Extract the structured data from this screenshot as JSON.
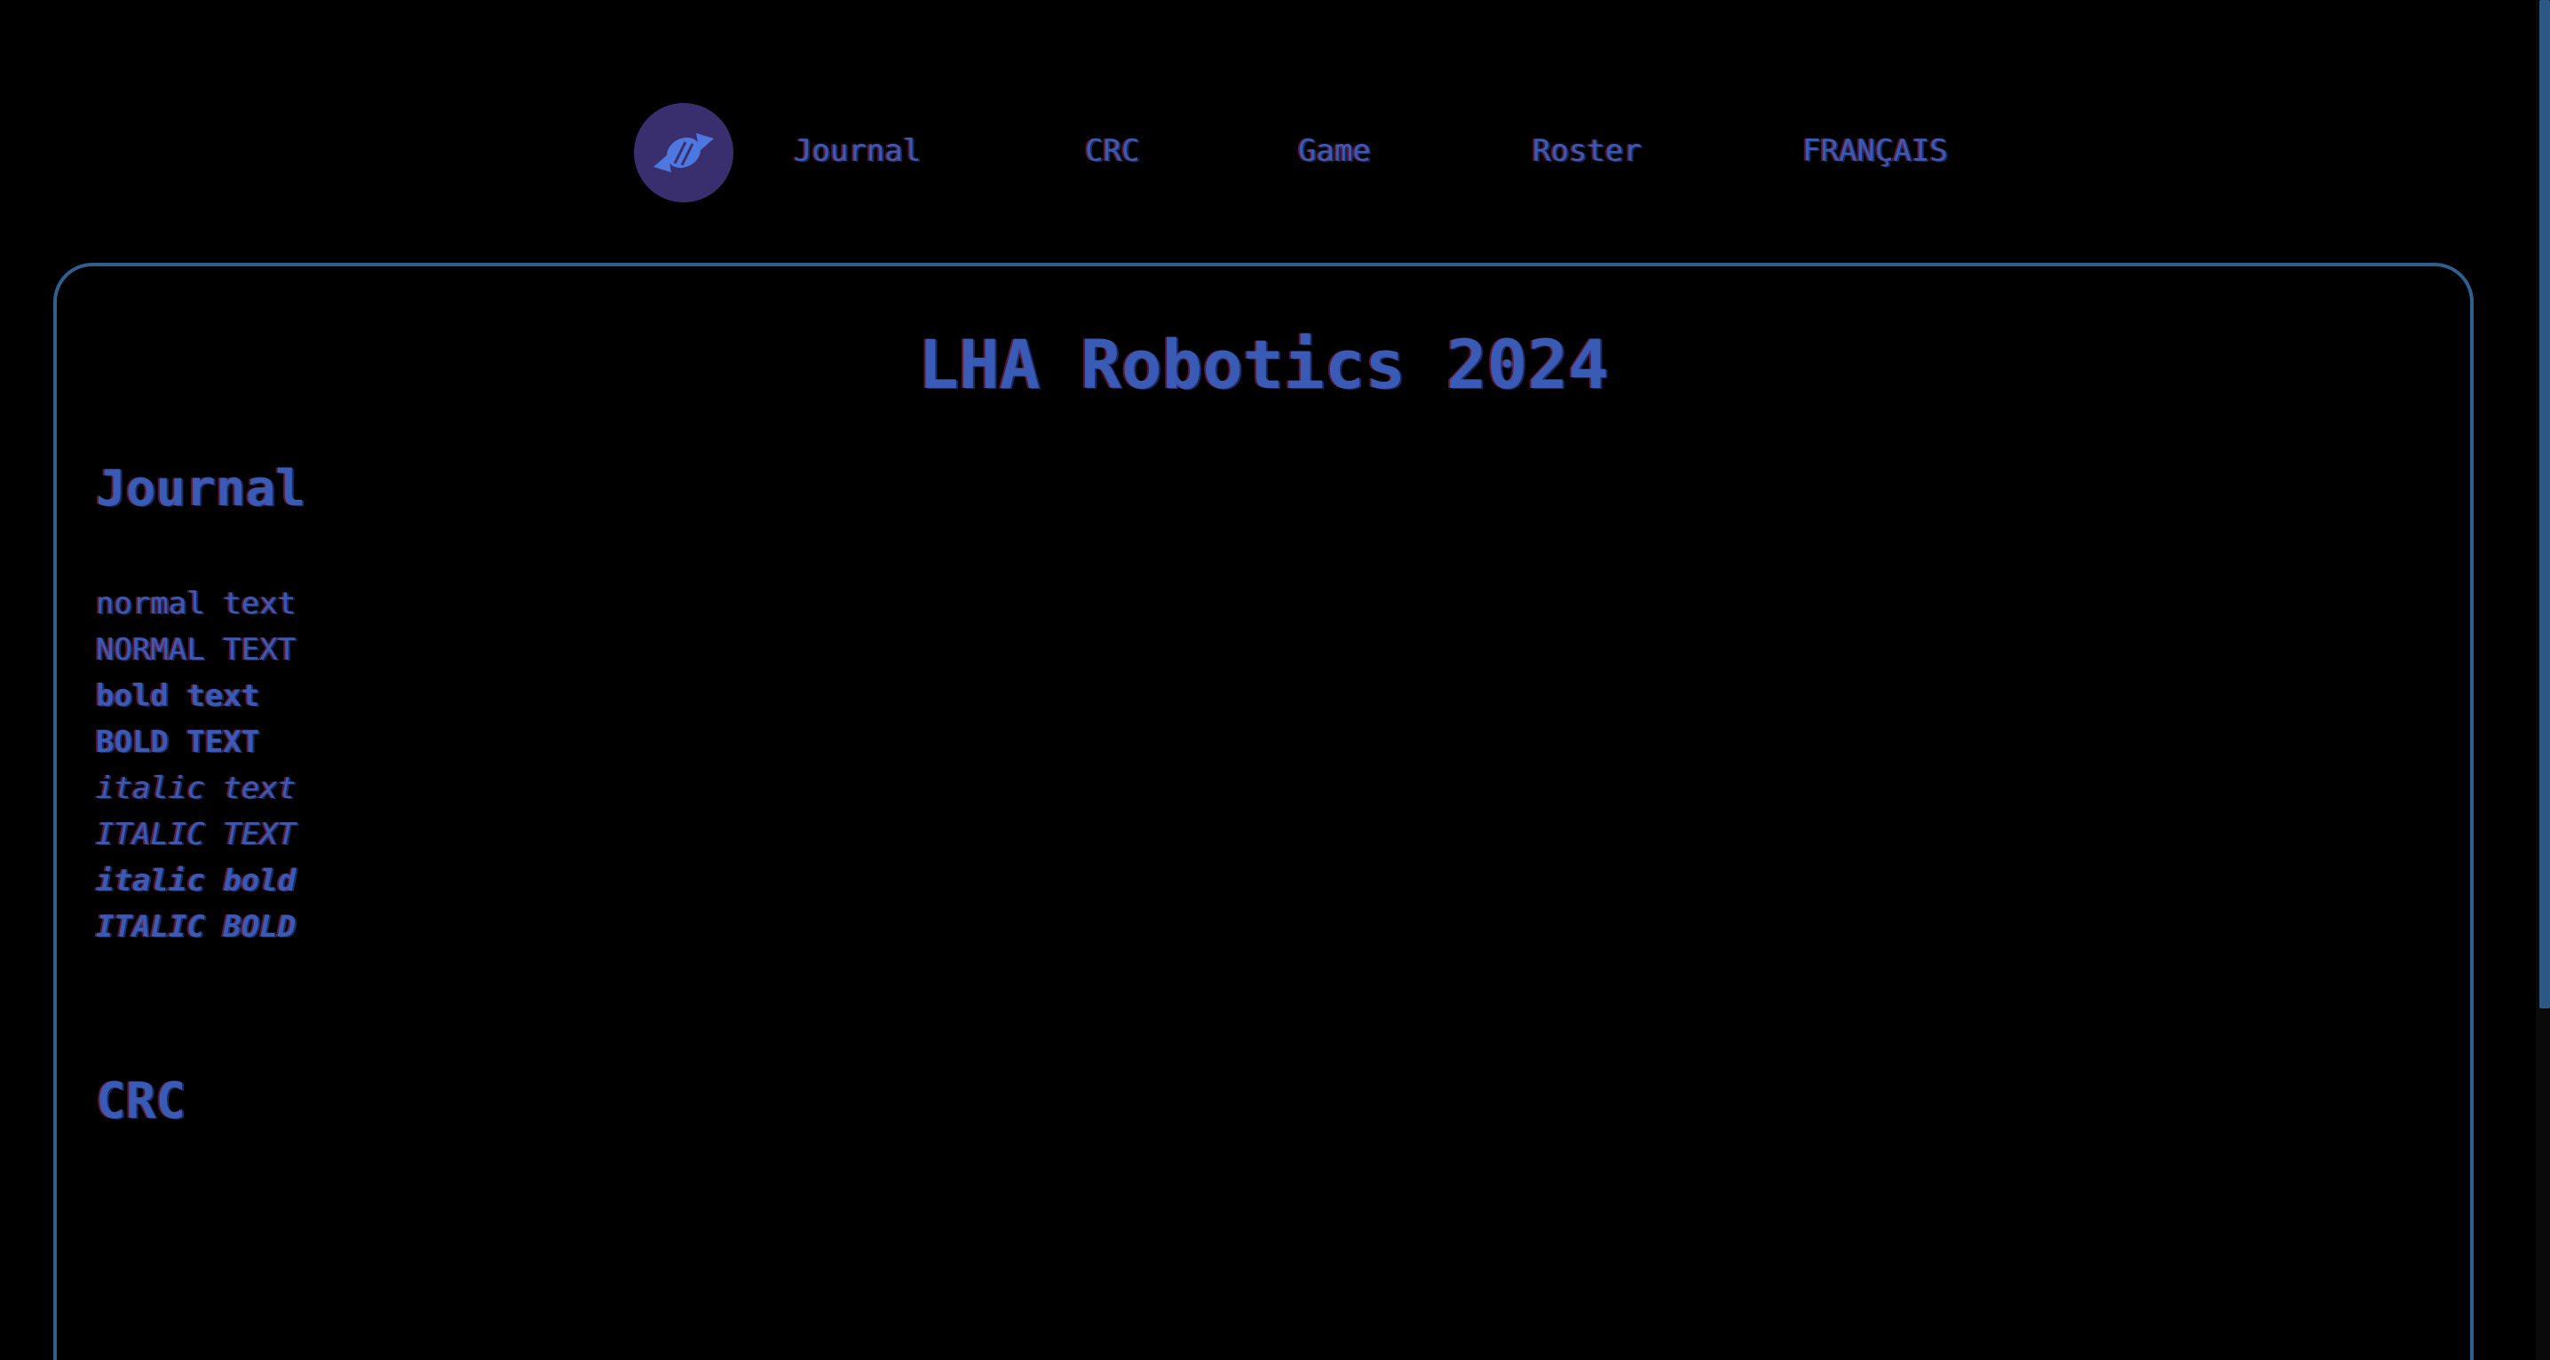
{
  "nav": {
    "logo_icon": "candy-icon",
    "links": [
      {
        "label": "Journal"
      },
      {
        "label": "CRC"
      },
      {
        "label": "Game"
      },
      {
        "label": "Roster"
      },
      {
        "label": "FRANÇAIS"
      }
    ]
  },
  "main": {
    "title": "LHA Robotics 2024",
    "sections": [
      {
        "heading": "Journal",
        "samples": [
          "normal text",
          "NORMAL TEXT",
          "bold text",
          "BOLD TEXT",
          "italic text",
          "ITALIC TEXT",
          "italic bold",
          "ITALIC BOLD"
        ]
      },
      {
        "heading": "CRC"
      }
    ]
  },
  "colors": {
    "background": "#000000",
    "text": "#3a5bb5",
    "card_border": "#2f5f8e",
    "logo_bg": "#3a2f6e",
    "scrollbar_thumb": "#2d5784"
  }
}
